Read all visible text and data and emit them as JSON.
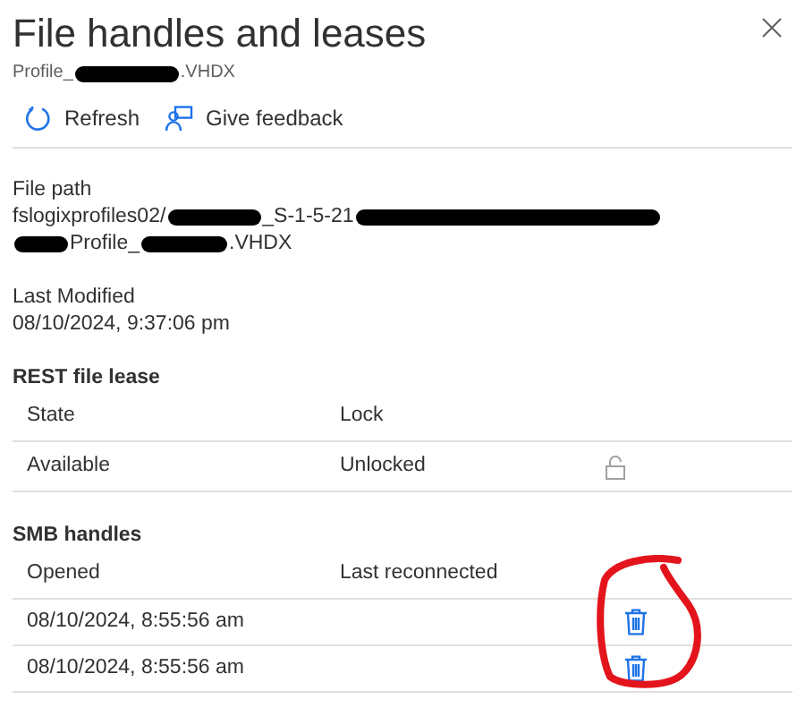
{
  "panel": {
    "title": "File handles and leases",
    "subtitle": [
      {
        "kind": "text",
        "text": "Profile_"
      },
      {
        "kind": "redacted"
      },
      {
        "kind": "text",
        "text": ".VHDX"
      }
    ]
  },
  "toolbar": [
    {
      "kind": "refresh",
      "label": "Refresh"
    },
    {
      "kind": "feedback",
      "label": "Give feedback"
    }
  ],
  "file_path": {
    "label": "File path",
    "lines": [
      [
        {
          "kind": "text",
          "text": "fslogixprofiles02/"
        },
        {
          "kind": "redacted"
        },
        {
          "kind": "text",
          "text": "_S-1-5-21"
        },
        {
          "kind": "redacted"
        }
      ],
      [
        {
          "kind": "redacted"
        },
        {
          "kind": "text",
          "text": "Profile_"
        },
        {
          "kind": "redacted"
        },
        {
          "kind": "text",
          "text": ".VHDX"
        }
      ]
    ]
  },
  "last_modified": {
    "label": "Last Modified",
    "value": "08/10/2024, 9:37:06 pm"
  },
  "rest_lease": {
    "heading": "REST file lease",
    "columns": [
      "State",
      "Lock"
    ],
    "rows": [
      {
        "state": "Available",
        "lock": "Unlocked",
        "locked": false
      }
    ]
  },
  "smb_handles": {
    "heading": "SMB handles",
    "columns": [
      "Opened",
      "Last reconnected"
    ],
    "rows": [
      {
        "opened": "08/10/2024, 8:55:56 am"
      },
      {
        "opened": "08/10/2024, 8:55:56 am"
      }
    ]
  },
  "annotation": {
    "kind": "circle"
  }
}
